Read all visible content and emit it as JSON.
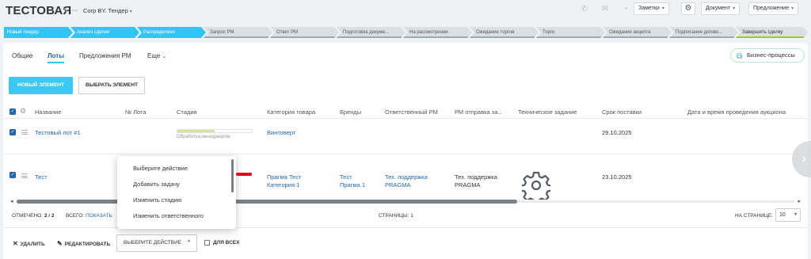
{
  "header": {
    "title": "ТЕСТОВАЯ",
    "company": "Corp BY. Тендер",
    "buttons": [
      "Заметки",
      "Документ",
      "Предложение"
    ]
  },
  "stages": [
    {
      "label": "Новый тендер",
      "state": "active"
    },
    {
      "label": "Анализ сделки",
      "state": "active"
    },
    {
      "label": "Распределено",
      "state": "active"
    },
    {
      "label": "Запрос РМ",
      "state": "inactive"
    },
    {
      "label": "Ответ РМ",
      "state": "inactive"
    },
    {
      "label": "Подготовка докуме...",
      "state": "inactive"
    },
    {
      "label": "На рассмотрении",
      "state": "inactive"
    },
    {
      "label": "Ожидание торгов",
      "state": "inactive"
    },
    {
      "label": "Торги",
      "state": "inactive"
    },
    {
      "label": "Ожидание акцепта",
      "state": "inactive"
    },
    {
      "label": "Подписание догово...",
      "state": "inactive"
    },
    {
      "label": "Завершить сделку",
      "state": "last"
    }
  ],
  "tabs": [
    {
      "label": "Общие",
      "active": false
    },
    {
      "label": "Лоты",
      "active": true
    },
    {
      "label": "Предложения РМ",
      "active": false
    },
    {
      "label": "Еще",
      "active": false
    }
  ],
  "business_process": "Бизнес-процессы",
  "toolbar": {
    "new_label": "НОВЫЙ ЭЛЕМЕНТ",
    "choose_label": "ВЫБРАТЬ ЭЛЕМЕНТ"
  },
  "columns": [
    "Название",
    "№ Лота",
    "Стадия",
    "Категория товара",
    "Бренды",
    "Ответственный РМ",
    "РМ отправка за...",
    "Техническое задание",
    "Срок поставки",
    "Дата и время проведения аукциона"
  ],
  "rows": [
    {
      "name": "Тестовый лот #1",
      "stage_label": "Обработка менеджером",
      "stage_progress": 0.5,
      "category": "Винтоверт",
      "brands": "",
      "responsible": "",
      "rm_send": "",
      "delivery": "29.10.2025"
    },
    {
      "name": "Тест",
      "category_line1": "Прагма Тест",
      "category_line2": "Категория 1",
      "brands_line1": "Тест",
      "brands_line2": "Прагма 1",
      "responsible_line1": "Тех. поддержка",
      "responsible_line2": "PRAGMA",
      "rm_send_line1": "Тех. поддержка",
      "rm_send_line2": "PRAGMA",
      "delivery": "23.10.2025"
    }
  ],
  "footer": {
    "marked_label": "ОТМЕЧЕНО:",
    "marked_value": "2 / 2",
    "total_label": "ВСЕГО:",
    "total_link": "ПОКАЗАТЬ",
    "pages_label": "СТРАНИЦЫ:",
    "pages_value": "1",
    "per_page_label": "НА СТРАНИЦЕ:",
    "per_page_value": "10"
  },
  "actions": {
    "delete": "УДАЛИТЬ",
    "edit": "РЕДАКТИРОВАТЬ",
    "select_action": "ВЫБЕРИТЕ ДЕЙСТВИЕ",
    "for_all": "ДЛЯ ВСЕХ"
  },
  "dropdown": {
    "items": [
      "Выберите действие",
      "Добавить задачу",
      "Изменить стадию",
      "Изменить ответственного"
    ]
  },
  "colors": {
    "accent": "#2fc6f6",
    "link": "#2067b0",
    "progress": "#d6e59a"
  }
}
